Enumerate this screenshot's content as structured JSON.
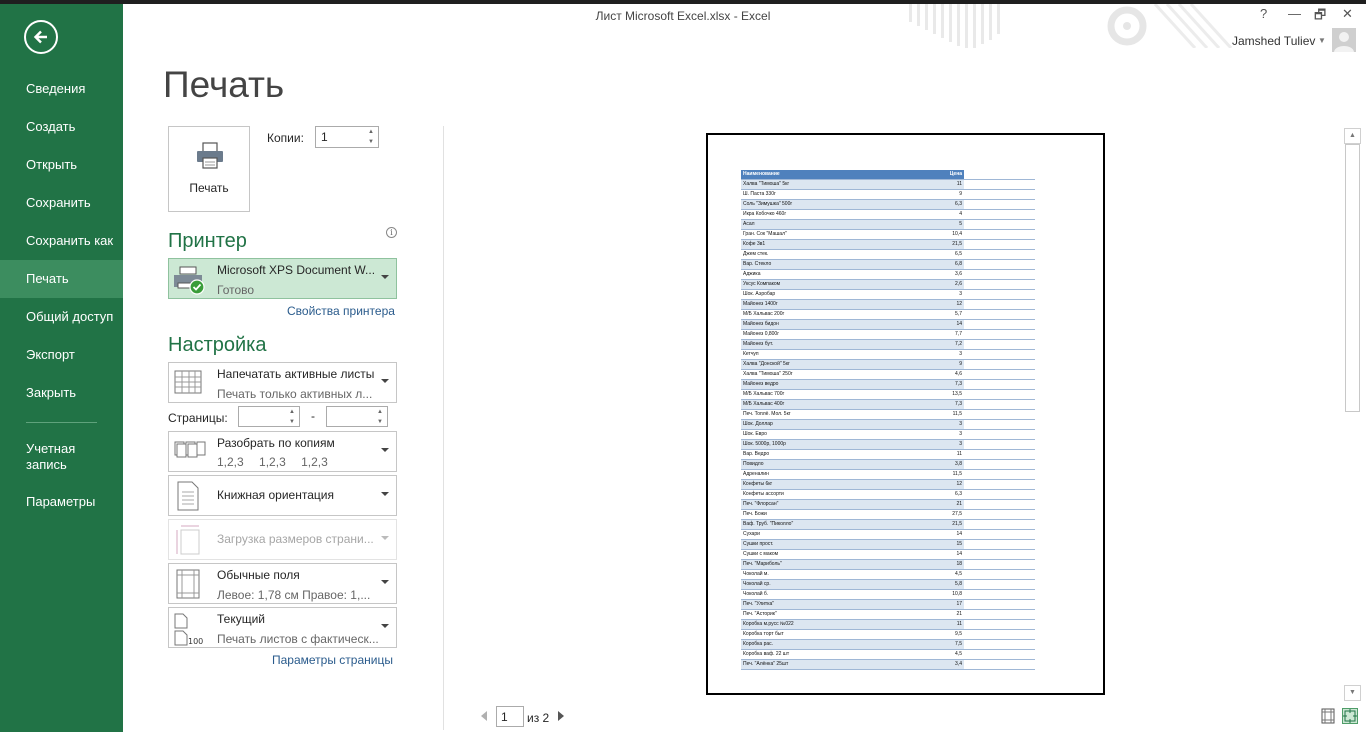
{
  "window": {
    "title": "Лист Microsoft Excel.xlsx - Excel",
    "help": "?",
    "restore": "🗗",
    "minimize": "—",
    "close": "✕",
    "user": "Jamshed Tuliev"
  },
  "sidebar": {
    "items": [
      {
        "label": "Сведения"
      },
      {
        "label": "Создать"
      },
      {
        "label": "Открыть"
      },
      {
        "label": "Сохранить"
      },
      {
        "label": "Сохранить как"
      },
      {
        "label": "Печать"
      },
      {
        "label": "Общий доступ"
      },
      {
        "label": "Экспорт"
      },
      {
        "label": "Закрыть"
      }
    ],
    "account_line1": "Учетная",
    "account_line2": "запись",
    "options": "Параметры"
  },
  "print": {
    "title": "Печать",
    "print_button": "Печать",
    "copies_label": "Копии:",
    "copies_value": "1"
  },
  "printer": {
    "heading": "Принтер",
    "info": "i",
    "name": "Microsoft XPS Document W...",
    "status": "Готово",
    "properties_link": "Свойства принтера"
  },
  "settings": {
    "heading": "Настройка",
    "active_sheets_title": "Напечатать активные листы",
    "active_sheets_sub": "Печать только активных л...",
    "pages_label": "Страницы:",
    "pages_dash": "-",
    "collate_title": "Разобрать по копиям",
    "collate_sub": [
      "1,2,3",
      "1,2,3",
      "1,2,3"
    ],
    "orientation": "Книжная ориентация",
    "paper_size": "Загрузка размеров страни...",
    "margins_title": "Обычные поля",
    "margins_sub": "Левое: 1,78 см    Правое: 1,...",
    "scaling_title": "Текущий",
    "scaling_sub": "Печать листов с фактическ...",
    "scaling_icon_text": "100",
    "page_setup_link": "Параметры страницы"
  },
  "preview": {
    "page_current": "1",
    "page_of": "из 2",
    "header": [
      "Наименование",
      "Цена"
    ],
    "rows": [
      [
        "Халва \"Тимоша\" 5кг",
        "11"
      ],
      [
        "Ш. Паста 330г",
        "9"
      ],
      [
        "Соль \"Зимушка\" 500г",
        "6,3"
      ],
      [
        "Икра Кобочко 460г",
        "4"
      ],
      [
        "Асал",
        "5"
      ],
      [
        "Гран. Сок \"Машал\"",
        "10,4"
      ],
      [
        "Кофе 3в1",
        "21,5"
      ],
      [
        "Джем стек.",
        "6,5"
      ],
      [
        "Вар. Стекло",
        "6,8"
      ],
      [
        "Аджика",
        "3,6"
      ],
      [
        "Уксус Компаком",
        "2,6"
      ],
      [
        "Шок. Аэробар",
        "3"
      ],
      [
        "Майонез 1400г",
        "12"
      ],
      [
        "М/Б Хальвас 200г",
        "5,7"
      ],
      [
        "Майонез бидон",
        "14"
      ],
      [
        "Майонез 0,800г",
        "7,7"
      ],
      [
        "Майонез бут.",
        "7,2"
      ],
      [
        "Кетчуп",
        "3"
      ],
      [
        "Халва \"Донской\" 5кг",
        "9"
      ],
      [
        "Халва \"Тимоша\" 250г",
        "4,6"
      ],
      [
        "Майонез ведро",
        "7,3"
      ],
      [
        "М/Б Хальвас 700г",
        "13,5"
      ],
      [
        "М/Б Хальвас 400г",
        "7,3"
      ],
      [
        "Печ. Топлё. Мол. 5кг",
        "11,5"
      ],
      [
        "Шок. Доллар",
        "3"
      ],
      [
        "Шок. Евро",
        "3"
      ],
      [
        "Шок. 5000р, 1000р",
        "3"
      ],
      [
        "Вар. Ведро",
        "11"
      ],
      [
        "Повидло",
        "3,8"
      ],
      [
        "Адреналин",
        "11,5"
      ],
      [
        "Конфеты 6кг",
        "12"
      ],
      [
        "Конфеты ассорти",
        "6,3"
      ],
      [
        "Печ. \"Флорсан\"",
        "21"
      ],
      [
        "Печ. Божи",
        "27,5"
      ],
      [
        "Ваф. Труб. \"Пиколло\"",
        "21,5"
      ],
      [
        "Сухари",
        "14"
      ],
      [
        "Сушки прост.",
        "15"
      ],
      [
        "Сушки с маком",
        "14"
      ],
      [
        "Печ. \"Мариболь\"",
        "18"
      ],
      [
        "Чоколай м.",
        "4,5"
      ],
      [
        "Чоколай ср.",
        "5,8"
      ],
      [
        "Чоколай б.",
        "10,8"
      ],
      [
        "Печ. \"Улитка\"",
        "17"
      ],
      [
        "Печ. \"Асторик\"",
        "21"
      ],
      [
        "Коробка м.русс №022",
        "11"
      ],
      [
        "Коробка торт быт",
        "9,5"
      ],
      [
        "Коробка рас.",
        "7,5"
      ],
      [
        "Коробка ваф. 22 шт",
        "4,5"
      ],
      [
        "Печ. \"Алёнка\" 25шт",
        "3,4"
      ]
    ]
  },
  "colors": {
    "sidebar": "#217346",
    "sidebar_active": "#3c8d5f",
    "section_heading": "#217346",
    "table_header": "#4f81bd",
    "table_band": "#dce6f1"
  },
  "icons": [
    "back-arrow-icon",
    "printer-icon",
    "printer-ready-icon",
    "sheets-icon",
    "collate-icon",
    "portrait-icon",
    "paper-size-icon",
    "margins-icon",
    "scaling-icon",
    "normal-margins-view-icon",
    "zoom-to-page-icon"
  ]
}
